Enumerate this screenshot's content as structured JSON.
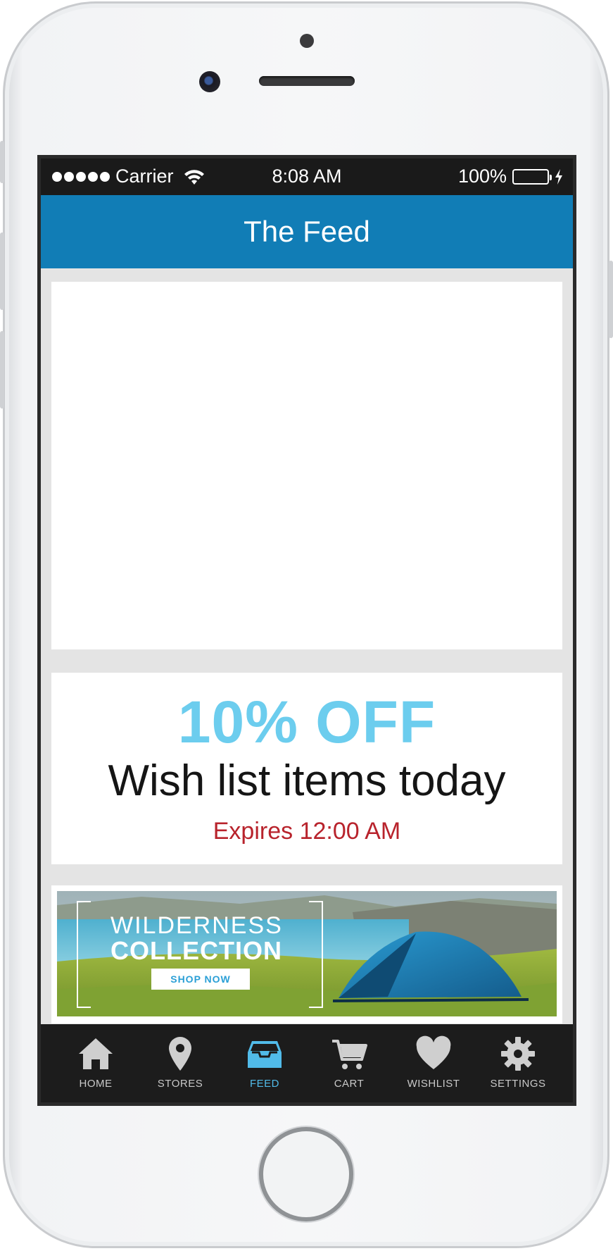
{
  "status_bar": {
    "carrier": "Carrier",
    "time": "8:08 AM",
    "battery": "100%"
  },
  "header": {
    "title": "The Feed"
  },
  "promo": {
    "headline": "10% OFF",
    "subtitle": "Wish list items today",
    "expiry": "Expires 12:00 AM"
  },
  "banner": {
    "title_line1": "WILDERNESS",
    "title_line2": "COLLECTION",
    "cta": "SHOP NOW"
  },
  "tabs": [
    {
      "label": "HOME",
      "icon": "home-icon"
    },
    {
      "label": "STORES",
      "icon": "location-pin-icon"
    },
    {
      "label": "FEED",
      "icon": "inbox-tray-icon",
      "active": true
    },
    {
      "label": "CART",
      "icon": "cart-icon"
    },
    {
      "label": "WISHLIST",
      "icon": "heart-icon"
    },
    {
      "label": "SETTINGS",
      "icon": "gear-icon"
    }
  ],
  "colors": {
    "header": "#117db6",
    "promo_headline": "#6ccdee",
    "expiry": "#b8232c",
    "tab_active": "#51bbe9",
    "tab_inactive": "#c9c9c9"
  }
}
